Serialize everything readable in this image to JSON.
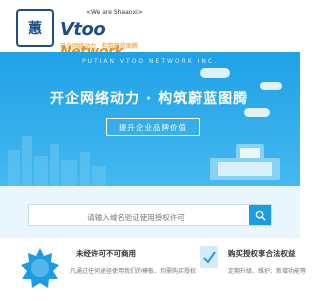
{
  "header": {
    "logo_glyph": "蕙",
    "brand_latin": "Vtoo",
    "brand_network": "Network",
    "brand_tagline": "<We are Shaanxi>",
    "brand_slogan": "开企网络动力 · 构筑蔚蓝图腾"
  },
  "hero": {
    "english_tagline": "PUTIAN VTOO NETWORK INC.",
    "title": "开企网络动力 · 构筑蔚蓝图腾",
    "cta_label": "提升企业品牌价值"
  },
  "search": {
    "placeholder": "请输入域名验证使用授权许可"
  },
  "features": [
    {
      "title": "未经许可不可商用",
      "desc": "凡通过任何途径使用我们的模板、均需购买授权"
    },
    {
      "title": "购买授权享合法权益",
      "desc": "定期升级、维护、新增功能等"
    }
  ],
  "colors": {
    "primary": "#1d9de1",
    "brand_dark": "#1e4e86",
    "accent_orange": "#f08f1b"
  }
}
